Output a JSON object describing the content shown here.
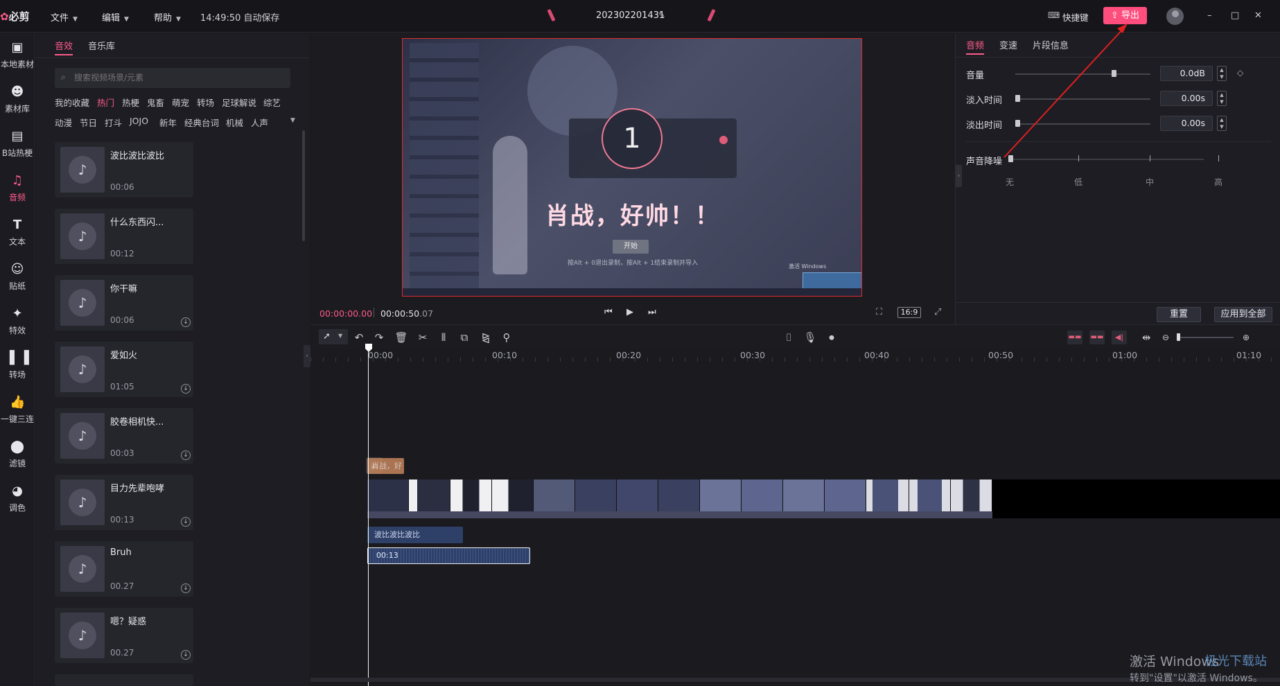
{
  "app": {
    "logo": "必剪",
    "project_name": "202302201431",
    "autosave": "14:49:50 自动保存"
  },
  "menu": {
    "file": "文件",
    "edit": "编辑",
    "help": "帮助"
  },
  "topbar": {
    "shortcut": "快捷键",
    "export": "导出",
    "minimize": "–",
    "maximize": "□",
    "close": "✕"
  },
  "nav": [
    {
      "label": "本地素材",
      "icon": "folder-icon"
    },
    {
      "label": "素材库",
      "icon": "emoji-icon"
    },
    {
      "label": "B站热梗",
      "icon": "tv-icon"
    },
    {
      "label": "音频",
      "icon": "music-icon",
      "active": true
    },
    {
      "label": "文本",
      "icon": "text-icon"
    },
    {
      "label": "贴纸",
      "icon": "sticker-icon"
    },
    {
      "label": "特效",
      "icon": "effect-icon"
    },
    {
      "label": "转场",
      "icon": "transition-icon"
    },
    {
      "label": "一键三连",
      "icon": "thumb-icon"
    },
    {
      "label": "滤镜",
      "icon": "filter-icon"
    },
    {
      "label": "调色",
      "icon": "palette-icon"
    }
  ],
  "library": {
    "tabs": [
      "音效",
      "音乐库"
    ],
    "search_placeholder": "搜索视频场景/元素",
    "tags_row1": [
      "我的收藏",
      "热门",
      "热梗",
      "鬼畜",
      "萌宠",
      "转场",
      "足球解说",
      "综艺"
    ],
    "tags_row2": [
      "动漫",
      "节日",
      "打斗",
      "JOJO",
      "新年",
      "经典台词",
      "机械",
      "人声"
    ],
    "active_tag": "热门",
    "items": [
      {
        "name": "波比波比波比",
        "duration": "00:06",
        "downloadable": false
      },
      {
        "name": "什么东西闪...",
        "duration": "00:12",
        "downloadable": false
      },
      {
        "name": "你干嘛",
        "duration": "00:06",
        "downloadable": true
      },
      {
        "name": "爱如火",
        "duration": "01:05",
        "downloadable": true
      },
      {
        "name": "胶卷相机快...",
        "duration": "00:03",
        "downloadable": true
      },
      {
        "name": "目力先辈咆哮",
        "duration": "00:13",
        "downloadable": true
      },
      {
        "name": "Bruh",
        "duration": "00.27",
        "downloadable": true
      },
      {
        "name": "嗯？疑惑",
        "duration": "00.27",
        "downloadable": true
      }
    ]
  },
  "preview": {
    "overlay_text": "肖战，好帅！！",
    "countdown": "1",
    "start_button": "开始",
    "hint": "按Alt + 0退出录制，按Alt + 1结束录制并导入",
    "watermark": "激活 Windows",
    "current_time": "00:00:00.00",
    "total_time_main": "00:00:50",
    "total_time_frac": ".07",
    "ratio": "16:9"
  },
  "properties": {
    "tabs": [
      "音频",
      "变速",
      "片段信息"
    ],
    "volume_label": "音量",
    "volume_value": "0.0dB",
    "volume_level": 0.73,
    "fadein_label": "淡入时间",
    "fadein_value": "0.00s",
    "fadeout_label": "淡出时间",
    "fadeout_value": "0.00s",
    "denoise_label": "声音降噪",
    "denoise_levels": [
      "无",
      "低",
      "中",
      "高"
    ],
    "reset": "重置",
    "apply_all": "应用到全部"
  },
  "timeline": {
    "ticks": [
      "00:00",
      "00:10",
      "00:20",
      "00:30",
      "00:40",
      "00:50",
      "01:00",
      "01:10"
    ],
    "text_clip": "肖战，好",
    "audio_clip1": "波比波比波比",
    "audio_clip2": "00:13"
  },
  "watermark": {
    "line1": "激活 Windows",
    "line2": "转到\"设置\"以激活 Windows。",
    "site": "极光下载站"
  },
  "colors": {
    "accent": "#ff5b8a",
    "export_bg": "#ff4d7e",
    "annotation_red": "#e02020",
    "selection": "#e22a2a"
  }
}
